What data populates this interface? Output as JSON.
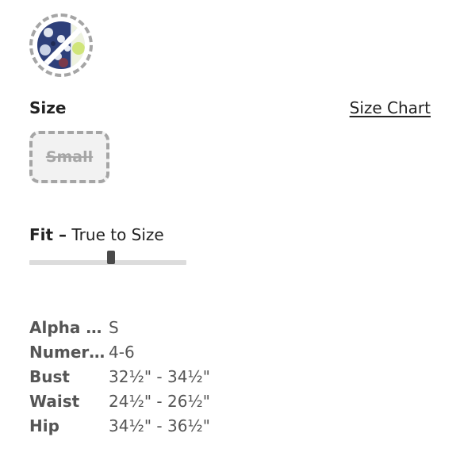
{
  "swatch": {
    "icon": "floral-pattern-swatch-icon",
    "status": "unavailable",
    "colors": [
      "#2d3f7a",
      "#dfe4ef",
      "#d0e57a",
      "#7a3a4a"
    ]
  },
  "size": {
    "label": "Size",
    "chart_link": "Size Chart",
    "options": [
      {
        "label": "Small",
        "status": "unavailable"
      }
    ]
  },
  "fit": {
    "key": "Fit –",
    "value": "True to Size",
    "slider_level": 0.5
  },
  "measurements": [
    {
      "key": "Alpha S...",
      "value": "S"
    },
    {
      "key": "Numeri...",
      "value": "4-6"
    },
    {
      "key": "Bust",
      "value": "32½\" - 34½\""
    },
    {
      "key": "Waist",
      "value": "24½\" - 26½\""
    },
    {
      "key": "Hip",
      "value": "34½\" - 36½\""
    }
  ]
}
